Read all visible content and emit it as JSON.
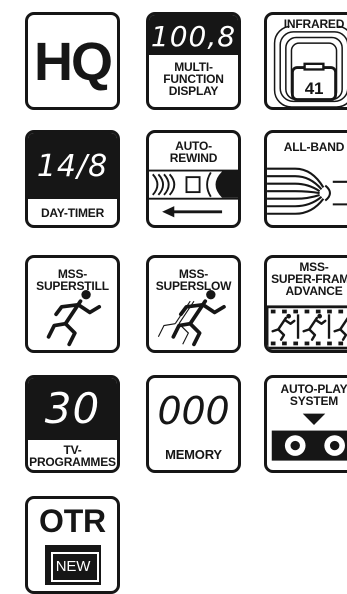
{
  "icons": {
    "hq": {
      "text": "HQ"
    },
    "multi_function_display": {
      "readout": "100,8",
      "label": "MULTI-\nFUNCTION\nDISPLAY"
    },
    "infrared": {
      "label": "INFRARED",
      "value": "41"
    },
    "day_timer": {
      "readout": "14/8",
      "label": "DAY-TIMER"
    },
    "auto_rewind": {
      "label": "AUTO-\nREWIND"
    },
    "all_band": {
      "label": "ALL-BAND"
    },
    "mss_superstill": {
      "label": "MSS-\nSUPERSTILL"
    },
    "mss_superslow": {
      "label": "MSS-\nSUPERSLOW"
    },
    "mss_super_frame_advance": {
      "label": "MSS-\nSUPER-FRAME\nADVANCE"
    },
    "tv_programmes": {
      "readout": "30",
      "label": "TV-\nPROGRAMMES"
    },
    "memory": {
      "readout": "000",
      "label": "MEMORY"
    },
    "auto_play_system": {
      "label": "AUTO-PLAY\nSYSTEM"
    },
    "otr": {
      "title": "OTR",
      "badge": "NEW"
    }
  },
  "colors": {
    "ink": "#161616",
    "paper": "#ffffff"
  }
}
